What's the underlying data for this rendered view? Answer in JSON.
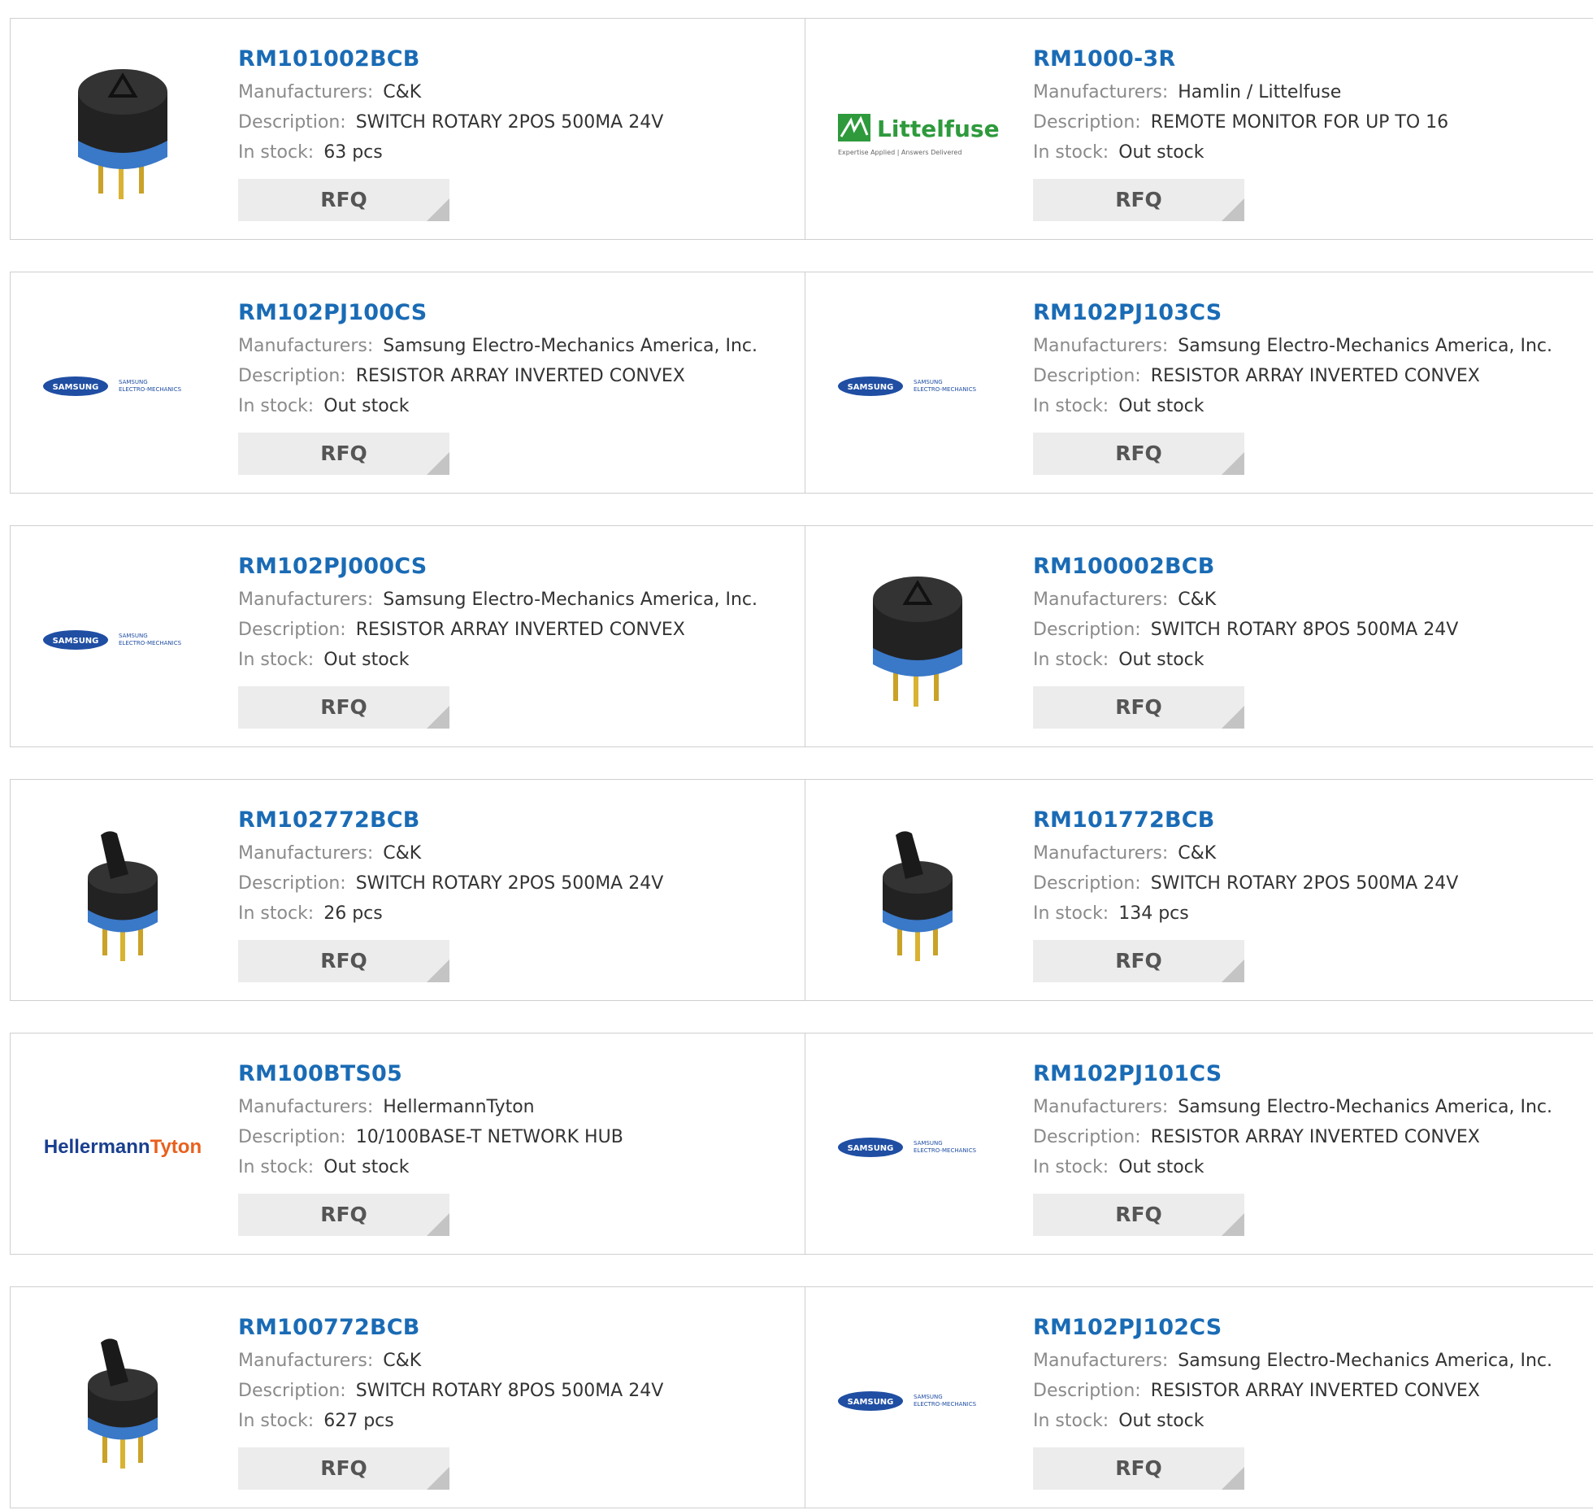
{
  "labels": {
    "manufacturers": "Manufacturers:",
    "description": "Description:",
    "stock": "In stock:",
    "rfq": "RFQ"
  },
  "products": [
    {
      "part": "RM101002BCB",
      "manufacturer": "C&K",
      "description": "SWITCH ROTARY 2POS 500MA 24V",
      "stock": "63 pcs",
      "image": "rotary-switch-image"
    },
    {
      "part": "RM1000-3R",
      "manufacturer": "Hamlin / Littelfuse",
      "description": "REMOTE MONITOR FOR UP TO 16",
      "stock": "Out stock",
      "image": "littelfuse-logo",
      "logo_text": "Littelfuse",
      "logo_tagline": "Expertise Applied | Answers Delivered"
    },
    {
      "part": "RM102PJ100CS",
      "manufacturer": "Samsung Electro-Mechanics America, Inc.",
      "description": "RESISTOR ARRAY INVERTED CONVEX",
      "stock": "Out stock",
      "image": "samsung-logo",
      "logo_text": "SAMSUNG",
      "logo_sub1": "SAMSUNG",
      "logo_sub2": "ELECTRO-MECHANICS"
    },
    {
      "part": "RM102PJ103CS",
      "manufacturer": "Samsung Electro-Mechanics America, Inc.",
      "description": "RESISTOR ARRAY INVERTED CONVEX",
      "stock": "Out stock",
      "image": "samsung-logo",
      "logo_text": "SAMSUNG",
      "logo_sub1": "SAMSUNG",
      "logo_sub2": "ELECTRO-MECHANICS"
    },
    {
      "part": "RM102PJ000CS",
      "manufacturer": "Samsung Electro-Mechanics America, Inc.",
      "description": "RESISTOR ARRAY INVERTED CONVEX",
      "stock": "Out stock",
      "image": "samsung-logo",
      "logo_text": "SAMSUNG",
      "logo_sub1": "SAMSUNG",
      "logo_sub2": "ELECTRO-MECHANICS"
    },
    {
      "part": "RM100002BCB",
      "manufacturer": "C&K",
      "description": "SWITCH ROTARY 8POS 500MA 24V",
      "stock": "Out stock",
      "image": "rotary-switch-image"
    },
    {
      "part": "RM102772BCB",
      "manufacturer": "C&K",
      "description": "SWITCH ROTARY 2POS 500MA 24V",
      "stock": "26 pcs",
      "image": "rotary-switch-shaft-image"
    },
    {
      "part": "RM101772BCB",
      "manufacturer": "C&K",
      "description": "SWITCH ROTARY 2POS 500MA 24V",
      "stock": "134 pcs",
      "image": "rotary-switch-shaft-image"
    },
    {
      "part": "RM100BTS05",
      "manufacturer": "HellermannTyton",
      "description": "10/100BASE-T NETWORK HUB",
      "stock": "Out stock",
      "image": "hellermanntyton-logo",
      "logo_text": "HellermannTyton"
    },
    {
      "part": "RM102PJ101CS",
      "manufacturer": "Samsung Electro-Mechanics America, Inc.",
      "description": "RESISTOR ARRAY INVERTED CONVEX",
      "stock": "Out stock",
      "image": "samsung-logo",
      "logo_text": "SAMSUNG",
      "logo_sub1": "SAMSUNG",
      "logo_sub2": "ELECTRO-MECHANICS"
    },
    {
      "part": "RM100772BCB",
      "manufacturer": "C&K",
      "description": "SWITCH ROTARY 8POS 500MA 24V",
      "stock": "627 pcs",
      "image": "rotary-switch-shaft-image"
    },
    {
      "part": "RM102PJ102CS",
      "manufacturer": "Samsung Electro-Mechanics America, Inc.",
      "description": "RESISTOR ARRAY INVERTED CONVEX",
      "stock": "Out stock",
      "image": "samsung-logo",
      "logo_text": "SAMSUNG",
      "logo_sub1": "SAMSUNG",
      "logo_sub2": "ELECTRO-MECHANICS"
    }
  ],
  "colors": {
    "part_link": "#1a6bb5",
    "label": "#8a8a8a",
    "value": "#333333",
    "rfq_bg": "#ececec",
    "samsung_blue": "#1f4ea3",
    "littelfuse_green": "#2e9a3c",
    "hellermann_blue": "#1a3f8f",
    "tyton_orange": "#e8601c"
  }
}
